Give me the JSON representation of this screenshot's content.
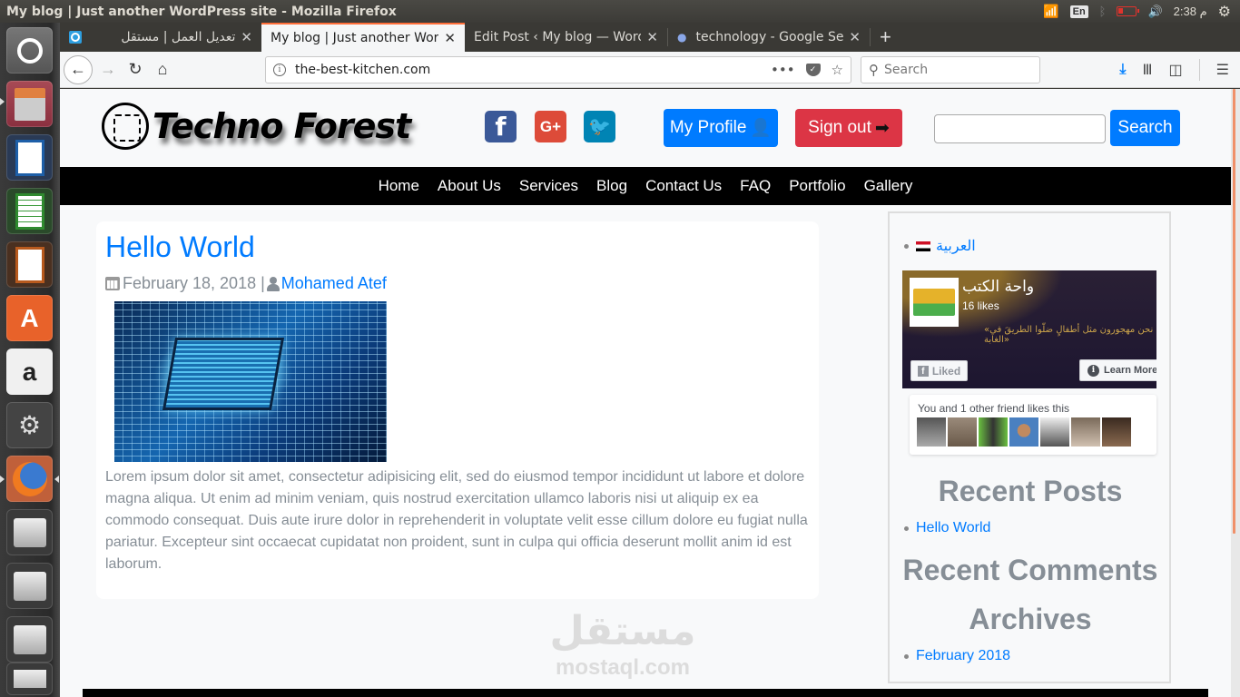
{
  "system": {
    "window_title": "My blog | Just another WordPress site - Mozilla Firefox",
    "keyboard_layout": "En",
    "clock": "2:38 م"
  },
  "launcher": {
    "items": [
      {
        "name": "ubuntu-dash",
        "icon": "ubuntu-logo-icon"
      },
      {
        "name": "files",
        "icon": "file-cabinet-icon"
      },
      {
        "name": "libreoffice-writer",
        "icon": "writer-doc-icon"
      },
      {
        "name": "libreoffice-calc",
        "icon": "calc-sheet-icon"
      },
      {
        "name": "libreoffice-impress",
        "icon": "impress-slide-icon"
      },
      {
        "name": "ubuntu-software",
        "icon": "software-bag-icon"
      },
      {
        "name": "amazon",
        "icon": "amazon-icon"
      },
      {
        "name": "system-settings",
        "icon": "settings-wrench-icon"
      },
      {
        "name": "firefox",
        "icon": "firefox-icon"
      },
      {
        "name": "drive-1",
        "icon": "hard-drive-icon"
      },
      {
        "name": "drive-2",
        "icon": "hard-drive-icon"
      },
      {
        "name": "drive-3",
        "icon": "hard-drive-icon"
      },
      {
        "name": "usb-drive",
        "icon": "usb-drive-icon"
      }
    ]
  },
  "browser": {
    "tabs": [
      {
        "label": "تعديل العمل | مستقل",
        "active": false
      },
      {
        "label": "My blog | Just another Word",
        "active": true
      },
      {
        "label": "Edit Post ‹ My blog — Word",
        "active": false
      },
      {
        "label": "technology - Google Sea",
        "active": false
      }
    ],
    "new_tab": "+",
    "close_glyph": "✕",
    "url": "the-best-kitchen.com",
    "search_placeholder": "Search"
  },
  "site": {
    "logo_text": "Techno Forest",
    "social": {
      "facebook": "f",
      "google_plus": "G+",
      "twitter": "🐦"
    },
    "my_profile": "My Profile",
    "sign_out": "Sign out",
    "search_value": "",
    "search_button": "Search",
    "nav": [
      "Home",
      "About Us",
      "Services",
      "Blog",
      "Contact Us",
      "FAQ",
      "Portfolio",
      "Gallery"
    ],
    "post": {
      "title": "Hello World",
      "date": "February 18, 2018",
      "separator": "|",
      "author": "Mohamed Atef",
      "body": "Lorem ipsum dolor sit amet, consectetur adipisicing elit, sed do eiusmod tempor incididunt ut labore et dolore magna aliqua. Ut enim ad minim veniam, quis nostrud exercitation ullamco laboris nisi ut aliquip ex ea commodo consequat. Duis aute irure dolor in reprehenderit in voluptate velit esse cillum dolore eu fugiat nulla pariatur. Excepteur sint occaecat cupidatat non proident, sunt in culpa qui officia deserunt mollit anim id est laborum."
    },
    "watermark": {
      "arabic": "مستقل",
      "latin": "mostaql.com"
    },
    "sidebar": {
      "language_link": "العربية",
      "fb_page": {
        "name": "واحة الكتب",
        "likes": "16 likes",
        "quote": "«نحن مهجورون مثل أطفالٍ ضلّوا الطريقَ في الغابة»",
        "liked_button": "Liked",
        "learn_more_button": "Learn More",
        "friends_text": "You and 1 other friend likes this",
        "friend_count_faces": 7
      },
      "recent_posts_title": "Recent Posts",
      "recent_posts": [
        "Hello World"
      ],
      "recent_comments_title": "Recent Comments",
      "archives_title": "Archives",
      "archives": [
        "February 2018"
      ]
    }
  },
  "colors": {
    "primary": "#007bff",
    "danger": "#dc3545",
    "muted": "#868e96",
    "facebook": "#3b5998",
    "google_plus": "#dd4b39",
    "twitter": "#0084b4",
    "tab_accent": "#ff6e39"
  }
}
